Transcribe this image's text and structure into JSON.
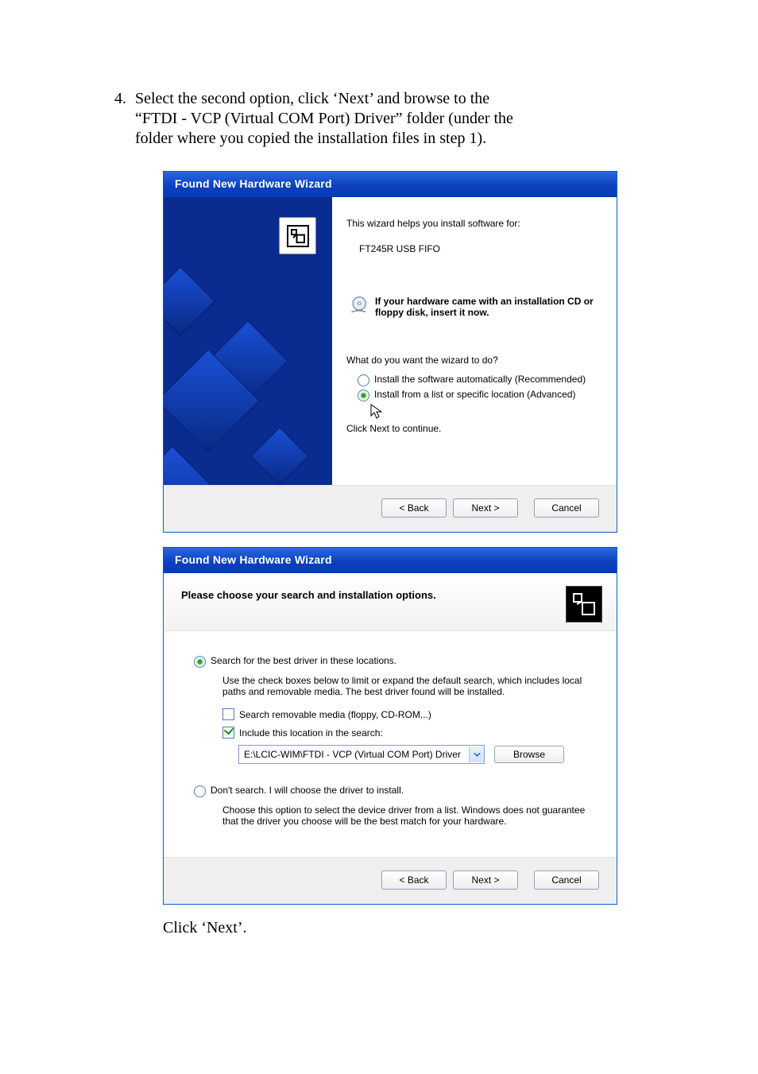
{
  "step_number": "4.",
  "instruction_line1": "Select the second option, click ‘Next’ and browse to the",
  "instruction_line2": "“FTDI - VCP (Virtual COM Port) Driver” folder (under the",
  "instruction_line3": "folder where you copied the installation files in step 1).",
  "closing_text": "Click ‘Next’.",
  "dialog1": {
    "title": "Found New Hardware Wizard",
    "intro": "This wizard helps you install software for:",
    "device": "FT245R USB FIFO",
    "cd_hint": "If your hardware came with an installation CD or floppy disk, insert it now.",
    "prompt": "What do you want the wizard to do?",
    "radio": [
      {
        "label": "Install the software automatically (Recommended)",
        "checked": false
      },
      {
        "label": "Install from a list or specific location (Advanced)",
        "checked": true
      }
    ],
    "continue_text": "Click Next to continue.",
    "buttons": {
      "back": "< Back",
      "next": "Next >",
      "cancel": "Cancel"
    }
  },
  "dialog2": {
    "title": "Found New Hardware Wizard",
    "heading": "Please choose your search and installation options.",
    "option1": {
      "label": "Search for the best driver in these locations.",
      "checked": true,
      "desc": "Use the check boxes below to limit or expand the default search, which includes local paths and removable media. The best driver found will be installed.",
      "cb_removable": {
        "label": "Search removable media (floppy, CD-ROM...)",
        "checked": false
      },
      "cb_include": {
        "label": "Include this location in the search:",
        "checked": true
      },
      "location_value": "E:\\LCIC-WIM\\FTDI - VCP (Virtual COM Port) Driver",
      "browse_label": "Browse"
    },
    "option2": {
      "label": "Don't search. I will choose the driver to install.",
      "checked": false,
      "desc": "Choose this option to select the device driver from a list.  Windows does not guarantee that the driver you choose will be the best match for your hardware."
    },
    "buttons": {
      "back": "< Back",
      "next": "Next >",
      "cancel": "Cancel"
    }
  }
}
